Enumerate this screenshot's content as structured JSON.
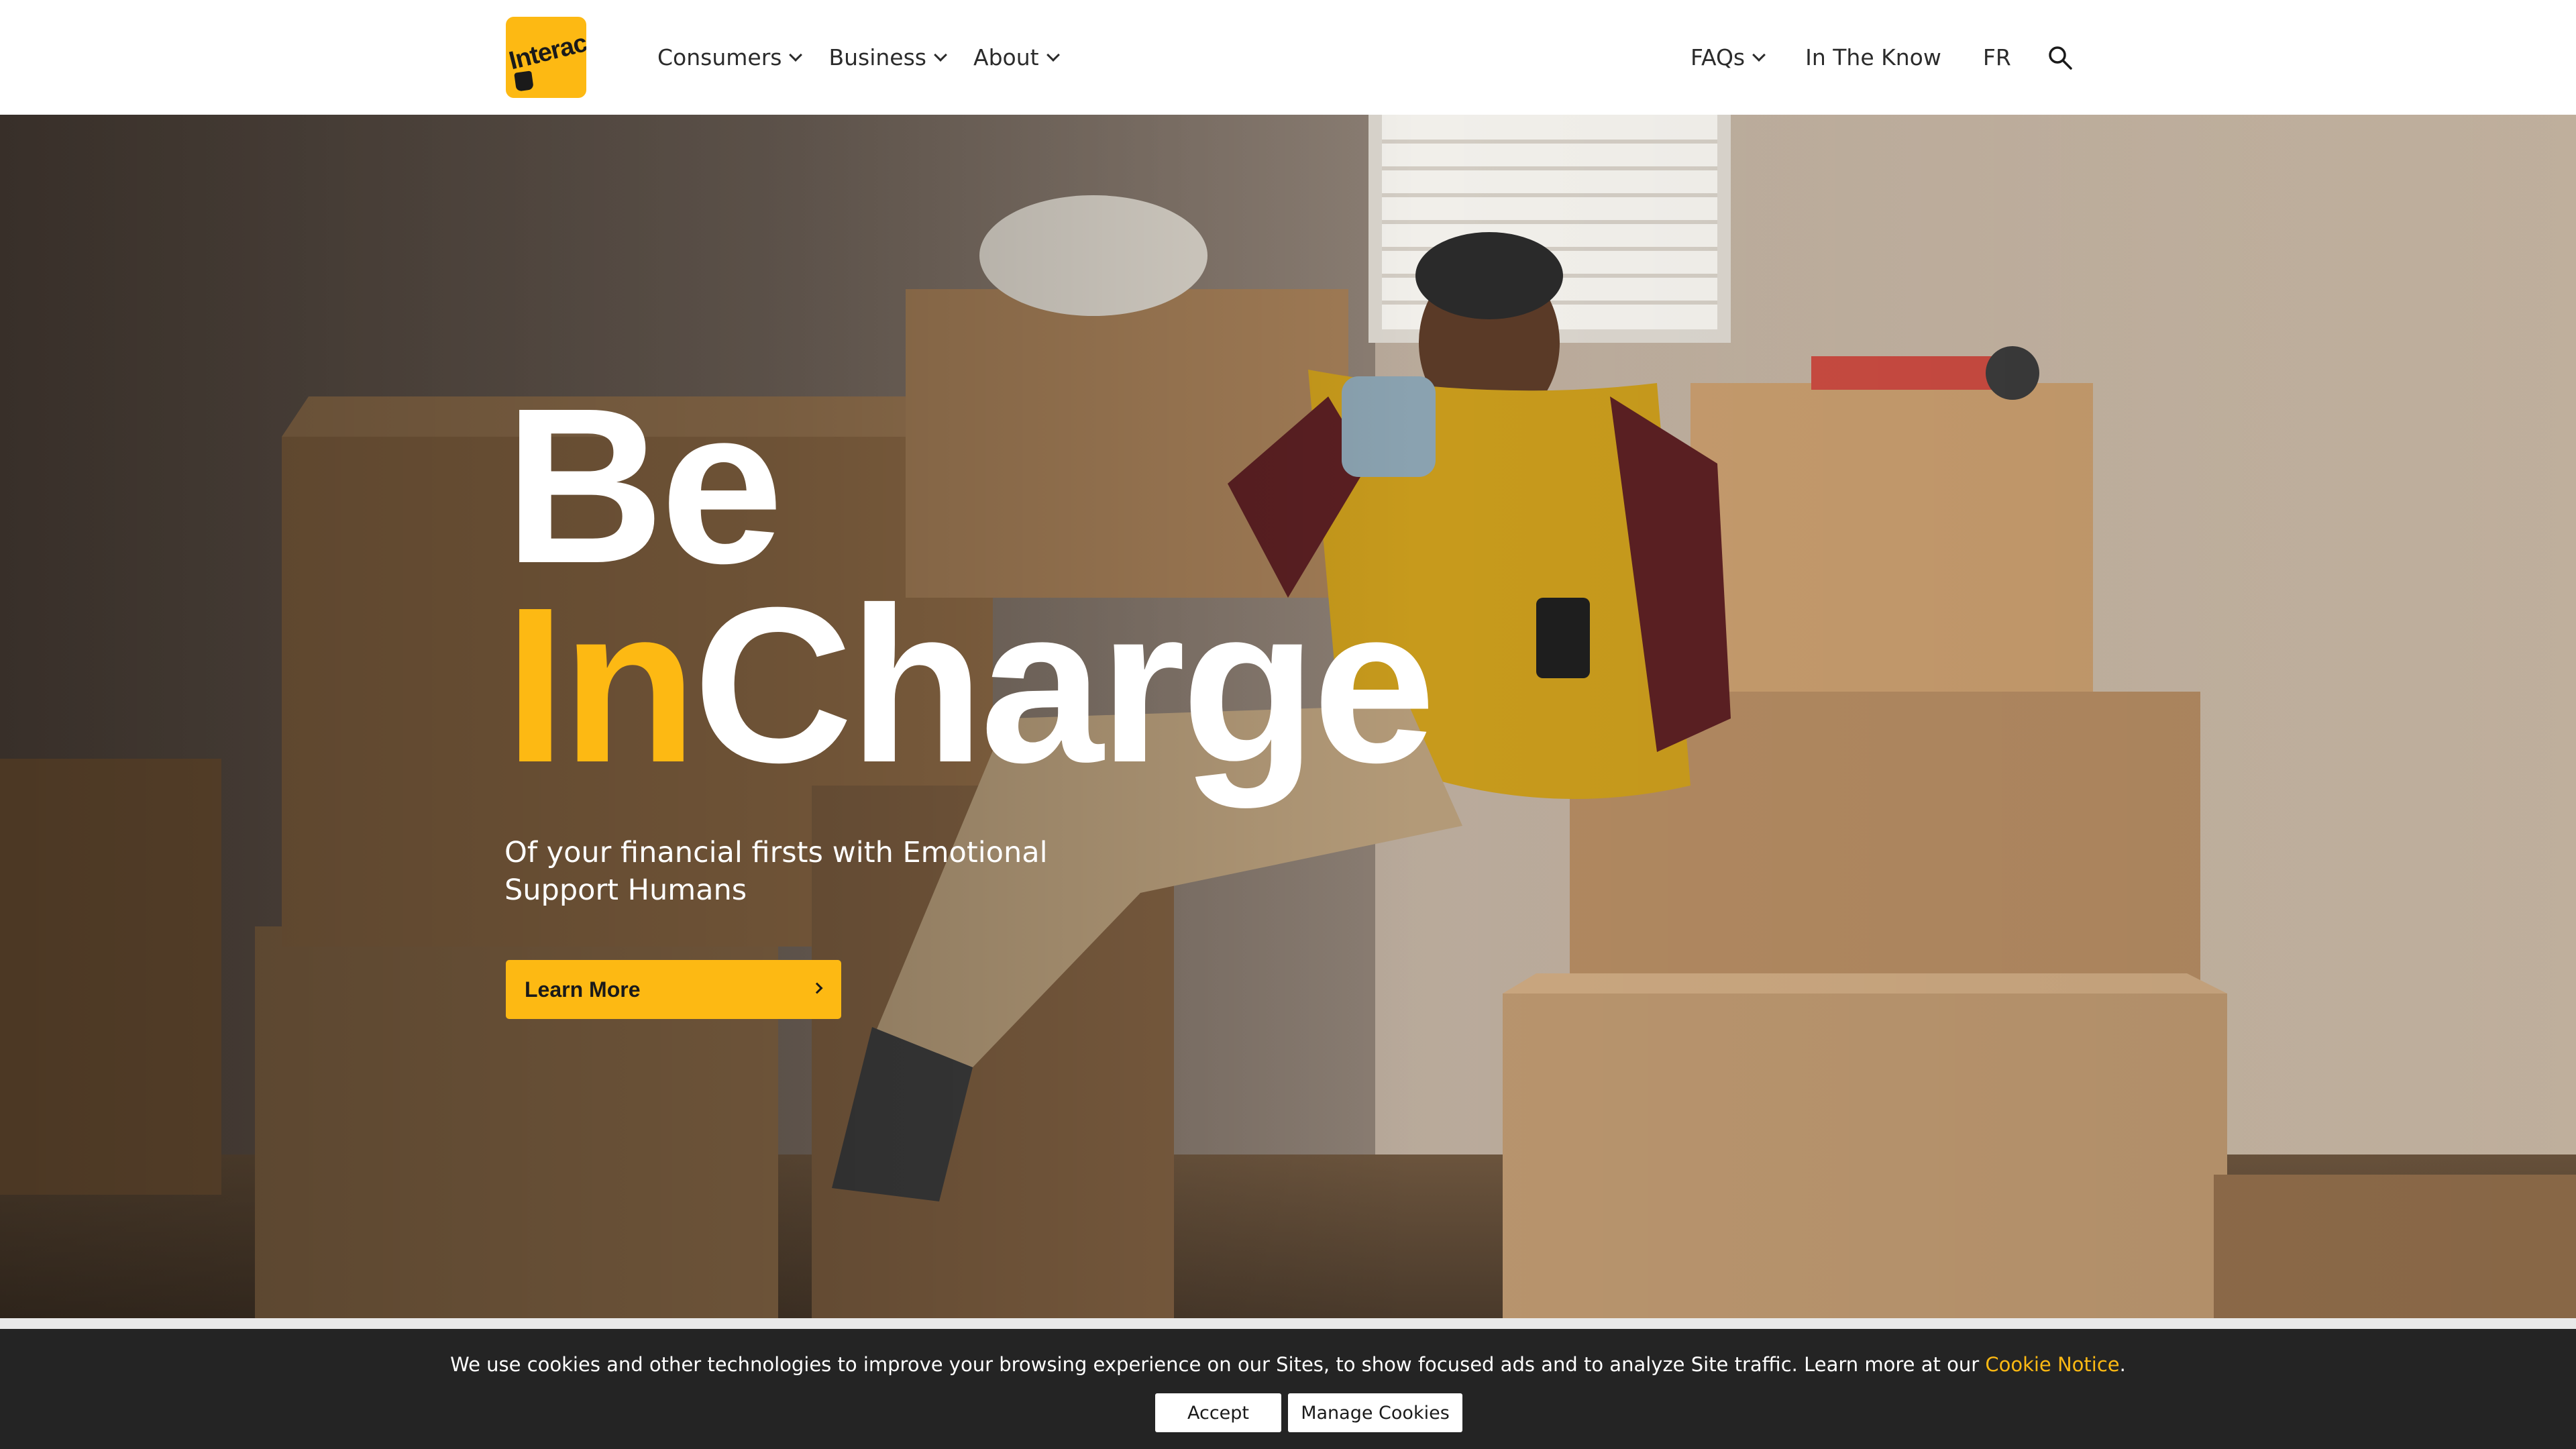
{
  "brand": {
    "logo_text": "Interac",
    "accent_color": "#fdb913"
  },
  "nav": {
    "left": [
      {
        "label": "Consumers",
        "dropdown": true
      },
      {
        "label": "Business",
        "dropdown": true
      },
      {
        "label": "About",
        "dropdown": true
      }
    ],
    "right": [
      {
        "label": "FAQs",
        "dropdown": true
      },
      {
        "label": "In The Know",
        "dropdown": false
      },
      {
        "label": "FR",
        "dropdown": false
      }
    ],
    "search_icon": "search-icon"
  },
  "hero": {
    "headline_line1": "Be",
    "headline_accent": "In",
    "headline_rest": "Charge",
    "subtext": "Of your financial firsts with Emotional Support Humans",
    "cta_label": "Learn More"
  },
  "cookie": {
    "text": "We use cookies and other technologies to improve your browsing experience on our Sites, to show focused ads and to analyze Site traffic. Learn more at our ",
    "link_label": "Cookie Notice",
    "text_end": ".",
    "accept_label": "Accept",
    "manage_label": "Manage Cookies"
  }
}
